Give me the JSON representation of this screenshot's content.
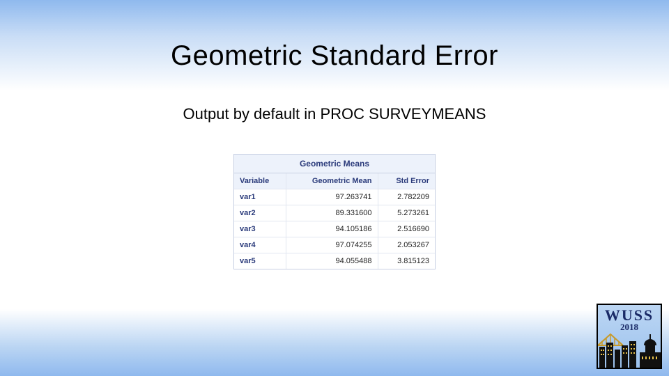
{
  "title": "Geometric Standard Error",
  "subtitle": "Output by default in PROC SURVEYMEANS",
  "table": {
    "caption": "Geometric Means",
    "headers": [
      "Variable",
      "Geometric Mean",
      "Std Error"
    ],
    "rows": [
      {
        "var": "var1",
        "mean": "97.263741",
        "stderr": "2.782209"
      },
      {
        "var": "var2",
        "mean": "89.331600",
        "stderr": "5.273261"
      },
      {
        "var": "var3",
        "mean": "94.105186",
        "stderr": "2.516690"
      },
      {
        "var": "var4",
        "mean": "97.074255",
        "stderr": "2.053267"
      },
      {
        "var": "var5",
        "mean": "94.055488",
        "stderr": "3.815123"
      }
    ]
  },
  "logo": {
    "text": "WUSS",
    "year": "2018"
  }
}
